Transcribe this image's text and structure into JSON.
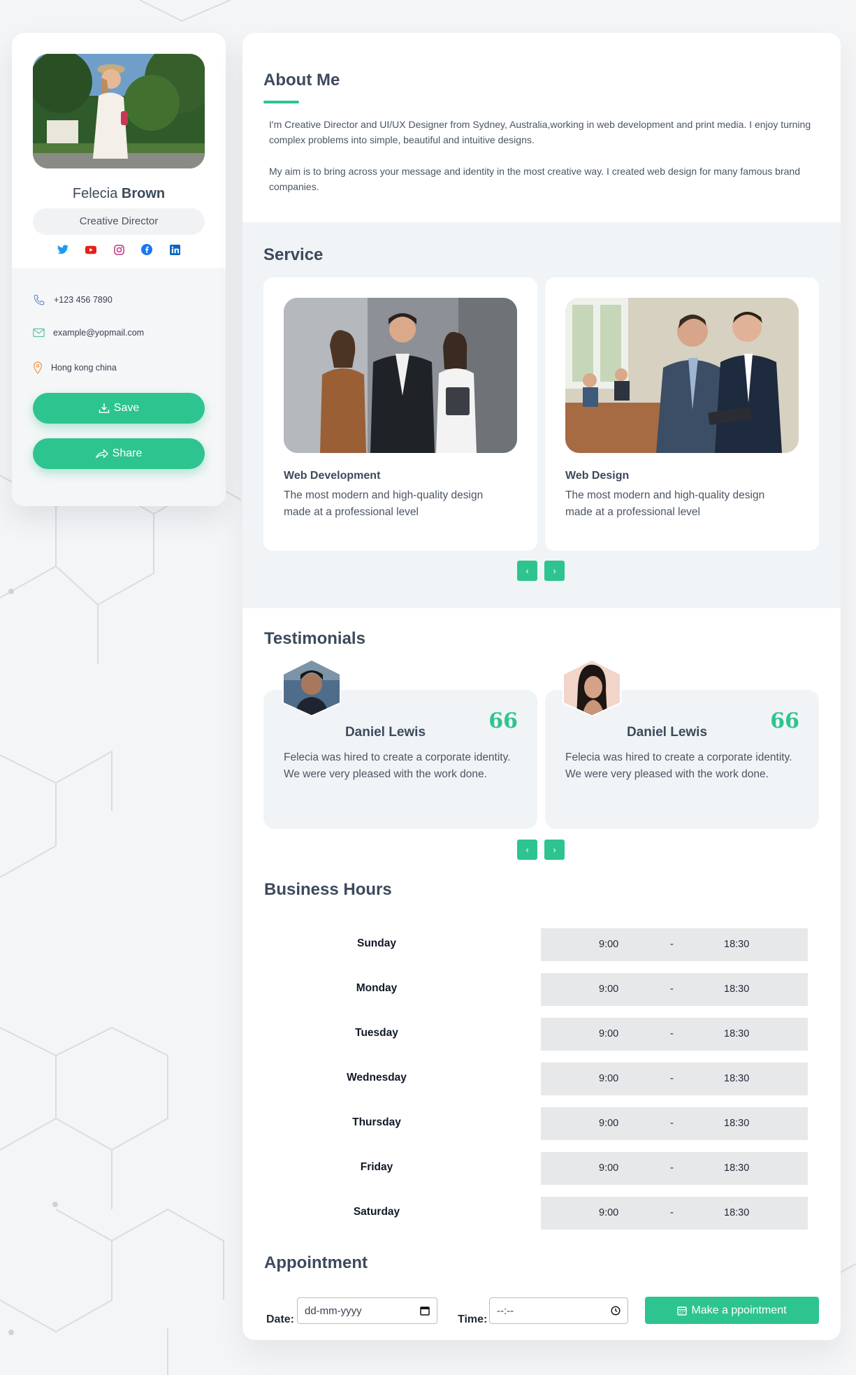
{
  "profile": {
    "first_name": "Felecia",
    "last_name": "Brown",
    "role": "Creative Director",
    "socials": [
      "twitter-icon",
      "youtube-icon",
      "instagram-icon",
      "facebook-icon",
      "linkedin-icon"
    ],
    "phone": "+123 456 7890",
    "email": "example@yopmail.com",
    "location": "Hong kong china",
    "save_label": "Save",
    "share_label": "Share"
  },
  "about": {
    "title": "About Me",
    "paragraph1": "I'm Creative Director and UI/UX Designer from Sydney, Australia,working in web development and print media. I enjoy turning complex problems into simple, beautiful and intuitive designs.",
    "paragraph2": "My aim is to bring across your message and identity in the most creative way. I created web design for many famous brand companies."
  },
  "service": {
    "title": "Service",
    "items": [
      {
        "title": "Web Development",
        "description": "The most modern and high-quality design made at a professional level"
      },
      {
        "title": "Web Design",
        "description": "The most modern and high-quality design made at a professional level"
      }
    ],
    "prev": "‹",
    "next": "›"
  },
  "testimonials": {
    "title": "Testimonials",
    "items": [
      {
        "name": "Daniel Lewis",
        "quote_mark": "66",
        "text": "Felecia was hired to create a corporate identity. We were very pleased with the work done."
      },
      {
        "name": "Daniel Lewis",
        "quote_mark": "66",
        "text": "Felecia was hired to create a corporate identity. We were very pleased with the work done."
      }
    ],
    "prev": "‹",
    "next": "›"
  },
  "hours": {
    "title": "Business Hours",
    "separator": "-",
    "rows": [
      {
        "day": "Sunday",
        "open": "9:00",
        "close": "18:30"
      },
      {
        "day": "Monday",
        "open": "9:00",
        "close": "18:30"
      },
      {
        "day": "Tuesday",
        "open": "9:00",
        "close": "18:30"
      },
      {
        "day": "Wednesday",
        "open": "9:00",
        "close": "18:30"
      },
      {
        "day": "Thursday",
        "open": "9:00",
        "close": "18:30"
      },
      {
        "day": "Friday",
        "open": "9:00",
        "close": "18:30"
      },
      {
        "day": "Saturday",
        "open": "9:00",
        "close": "18:30"
      }
    ]
  },
  "appointment": {
    "title": "Appointment",
    "date_label": "Date:",
    "date_placeholder": "dd-mm-yyyy",
    "time_label": "Time:",
    "time_placeholder": "--:--",
    "button_label": "Make a ppointment"
  },
  "colors": {
    "accent": "#2ec48f",
    "text": "#3c4a5c",
    "band": "#f1f4f6"
  }
}
